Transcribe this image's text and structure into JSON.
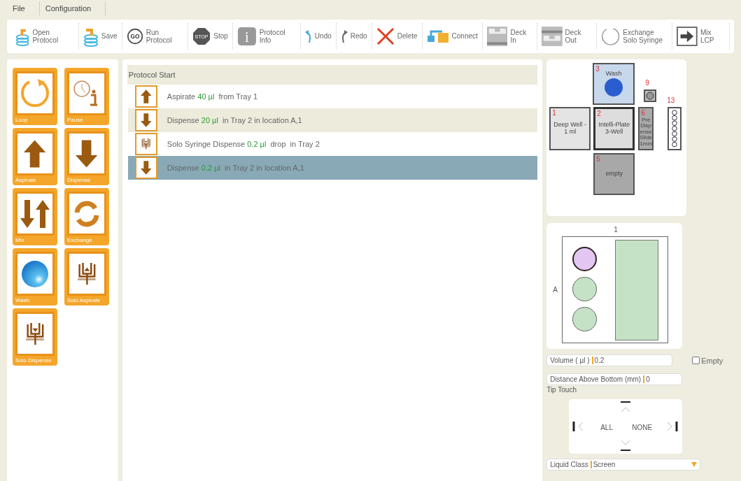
{
  "menu": [
    {
      "label": "File",
      "selected": false
    },
    {
      "label": "Configuration",
      "selected": false
    }
  ],
  "toolbar": [
    {
      "kind": "open",
      "label": "Open Protocol"
    },
    {
      "kind": "save",
      "label": "Save"
    },
    {
      "kind": "run",
      "label": "Run Protocol",
      "badge": "GO"
    },
    {
      "kind": "stop",
      "label": "Stop",
      "badge": "STOP"
    },
    {
      "kind": "info",
      "label": "Protocol Info",
      "badge": "i"
    },
    {
      "kind": "undo",
      "label": "Undo"
    },
    {
      "kind": "redo",
      "label": "Redo"
    },
    {
      "kind": "delete",
      "label": "Delete"
    },
    {
      "kind": "connect",
      "label": "Connect"
    },
    {
      "kind": "deckin",
      "label": "Deck In"
    },
    {
      "kind": "deckout",
      "label": "Deck Out"
    },
    {
      "kind": "exchange",
      "label": "Exchange Solo Syringe"
    },
    {
      "kind": "mix",
      "label": "Mix LCP"
    }
  ],
  "palette": [
    {
      "kind": "loop",
      "label": "Loop"
    },
    {
      "kind": "pause",
      "label": "Pause"
    },
    {
      "kind": "aspirate",
      "label": "Aspirate"
    },
    {
      "kind": "dispense",
      "label": "Dispense"
    },
    {
      "kind": "mix",
      "label": "Mix"
    },
    {
      "kind": "exchange",
      "label": "Exchange"
    },
    {
      "kind": "wash",
      "label": "Wash"
    },
    {
      "kind": "solo_aspirate",
      "label": "Solo Aspirate"
    },
    {
      "kind": "solo_dispense",
      "label": "Solo Dispense"
    }
  ],
  "protocol": {
    "header": "Protocol Start",
    "steps": [
      {
        "kind": "aspirate",
        "action": "Aspirate",
        "volume": "40 µl",
        "rest": "from Tray 1",
        "selected": false
      },
      {
        "kind": "dispense",
        "action": "Dispense",
        "volume": "20 µl",
        "rest": "in Tray 2 in location A,1",
        "selected": false
      },
      {
        "kind": "solo_dispense",
        "action": "Solo Syringe Dispense",
        "volume": "0.2 µl",
        "rest": "drop  in Tray 2",
        "selected": false
      },
      {
        "kind": "dispense",
        "action": "Dispense",
        "volume": "0.2 µl",
        "rest": "in Tray 2 in location A,1",
        "selected": true
      }
    ]
  },
  "deck": [
    {
      "kind": "wash",
      "number": "3",
      "label": "Wash",
      "selected": false
    },
    {
      "kind": "small",
      "number": "9",
      "selected": false
    },
    {
      "kind": "plate",
      "number": "1",
      "label": "Deep Well - 1 ml",
      "selected": false
    },
    {
      "kind": "plate",
      "number": "2",
      "label": "Intelli-Plate 3-Well",
      "selected": true
    },
    {
      "kind": "slide",
      "number": "6",
      "label": "Pre Dispense Slide 1mm",
      "selected": false
    },
    {
      "kind": "strip",
      "number": "13",
      "selected": false
    },
    {
      "kind": "empty",
      "number": "5",
      "label": "empty",
      "selected": false
    }
  ],
  "plate": {
    "column": "1",
    "row": "A",
    "wells": [
      {
        "selected": true
      },
      {
        "selected": false
      },
      {
        "selected": false
      }
    ]
  },
  "volume": {
    "label": "Volume ( µl )",
    "value": "0.2"
  },
  "empty": {
    "label": "Empty",
    "checked": false
  },
  "distance": {
    "label": "Distance Above Bottom (mm)",
    "value": "0"
  },
  "tip_touch": {
    "label": "Tip Touch",
    "all": "ALL",
    "none": "NONE"
  },
  "liquid_class": {
    "label": "Liquid Class",
    "value": "Screen"
  }
}
